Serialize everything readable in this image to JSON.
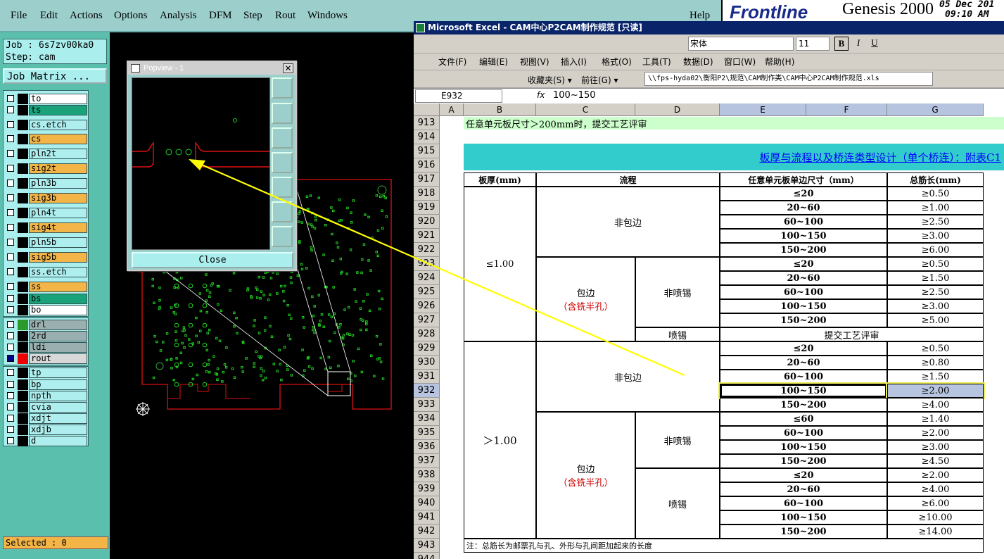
{
  "genesis": {
    "menu": [
      "File",
      "Edit",
      "Actions",
      "Options",
      "Analysis",
      "DFM",
      "Step",
      "Rout",
      "Windows"
    ],
    "help": "Help",
    "logo_brand": "Frontline",
    "logo_product": "Genesis 2000",
    "date": "05 Dec 201",
    "time": "09:10 AM",
    "job": "Job : 6s7zv00ka0",
    "step": "Step: cam",
    "job_matrix": "Job Matrix ...",
    "layers": [
      {
        "name": "to",
        "color": "#ffffff"
      },
      {
        "name": "ts",
        "color": "#1aa37a"
      },
      {
        "name": "cs.etch",
        "color": "#aeeeee"
      },
      {
        "name": "cs",
        "color": "#f3b548"
      },
      {
        "name": "pln2t",
        "color": "#aeeeee"
      },
      {
        "name": "sig2t",
        "color": "#f3b548"
      },
      {
        "name": "pln3b",
        "color": "#aeeeee"
      },
      {
        "name": "sig3b",
        "color": "#f3b548"
      },
      {
        "name": "pln4t",
        "color": "#aeeeee"
      },
      {
        "name": "sig4t",
        "color": "#f3b548"
      },
      {
        "name": "pln5b",
        "color": "#aeeeee"
      },
      {
        "name": "sig5b",
        "color": "#f3b548"
      },
      {
        "name": "ss.etch",
        "color": "#aeeeee"
      },
      {
        "name": "ss",
        "color": "#f3b548"
      },
      {
        "name": "bs",
        "color": "#1aa37a"
      },
      {
        "name": "bo",
        "color": "#ffffff"
      },
      {
        "name": "drl",
        "color": "#9ab0b0"
      },
      {
        "name": "2rd",
        "color": "#9ab0b0"
      },
      {
        "name": "ldi",
        "color": "#9ab0b0"
      },
      {
        "name": "rout",
        "color": "#d8d8d8"
      },
      {
        "name": "tp",
        "color": "#aeeeee"
      },
      {
        "name": "bp",
        "color": "#aeeeee"
      },
      {
        "name": "npth",
        "color": "#aeeeee"
      },
      {
        "name": "cvia",
        "color": "#aeeeee"
      },
      {
        "name": "xdjt",
        "color": "#aeeeee"
      },
      {
        "name": "xdjb",
        "color": "#aeeeee"
      },
      {
        "name": "d",
        "color": "#aeeeee"
      }
    ],
    "selected": "Selected : 0",
    "popview_title": "Popview - 1",
    "close": "Close"
  },
  "excel": {
    "title": "Microsoft Excel - CAM中心P2CAM制作规范 [只读]",
    "font": "宋体",
    "font_size": "11",
    "menu": [
      "文件(F)",
      "编辑(E)",
      "视图(V)",
      "插入(I)",
      "格式(O)",
      "工具(T)",
      "数据(D)",
      "窗口(W)",
      "帮助(H)"
    ],
    "favorites": "收藏夹(S) ▾",
    "goto": "前往(G) ▾",
    "path": "\\\\fps-hyda02\\衡阳P2\\规范\\CAM制作类\\CAM中心P2CAM制作规范.xls",
    "cell_ref": "E932",
    "formula": "100~150",
    "columns": [
      "A",
      "B",
      "C",
      "D",
      "E",
      "F",
      "G"
    ],
    "rows": [
      "913",
      "914",
      "915",
      "916",
      "917",
      "918",
      "919",
      "920",
      "921",
      "922",
      "923",
      "924",
      "925",
      "926",
      "927",
      "928",
      "929",
      "930",
      "931",
      "932",
      "933",
      "934",
      "935",
      "936",
      "937",
      "938",
      "939",
      "940",
      "941",
      "942",
      "943",
      "944"
    ],
    "note_913": "任意单元板尺寸＞200mm时，提交工艺评审",
    "table_title": "板厚与流程以及桥连类型设计（单个桥连）：附表C1",
    "headers": [
      "板厚(mm)",
      "流程",
      "任意单元板单边尺寸（mm）",
      "总筋长(mm)"
    ],
    "thickness_1": "≤1.00",
    "thickness_2": "＞1.00",
    "non_edge": "非包边",
    "edge": "包边",
    "edge_note": "（含铣半孔）",
    "non_spray": "非喷锡",
    "spray": "喷锡",
    "review": "提交工艺评审",
    "sizes_a": [
      "≤20",
      "20~60",
      "60~100",
      "100~150",
      "150~200"
    ],
    "len_a": [
      "≥0.50",
      "≥1.00",
      "≥2.50",
      "≥3.00",
      "≥6.00"
    ],
    "len_b": [
      "≥0.50",
      "≥1.50",
      "≥2.50",
      "≥3.00",
      "≥5.00"
    ],
    "len_c": [
      "≥0.50",
      "≥0.80",
      "≥1.50",
      "≥2.00",
      "≥4.00"
    ],
    "sizes_d": [
      "≤60",
      "60~100",
      "100~150",
      "150~200"
    ],
    "len_d": [
      "≥1.40",
      "≥2.00",
      "≥3.00",
      "≥4.50"
    ],
    "len_e": [
      "≥2.00",
      "≥4.00",
      "≥6.00",
      "≥10.00",
      "≥14.00"
    ],
    "footnote": "注：总筋长为邮票孔与孔、外形与孔间距加起来的长度"
  }
}
